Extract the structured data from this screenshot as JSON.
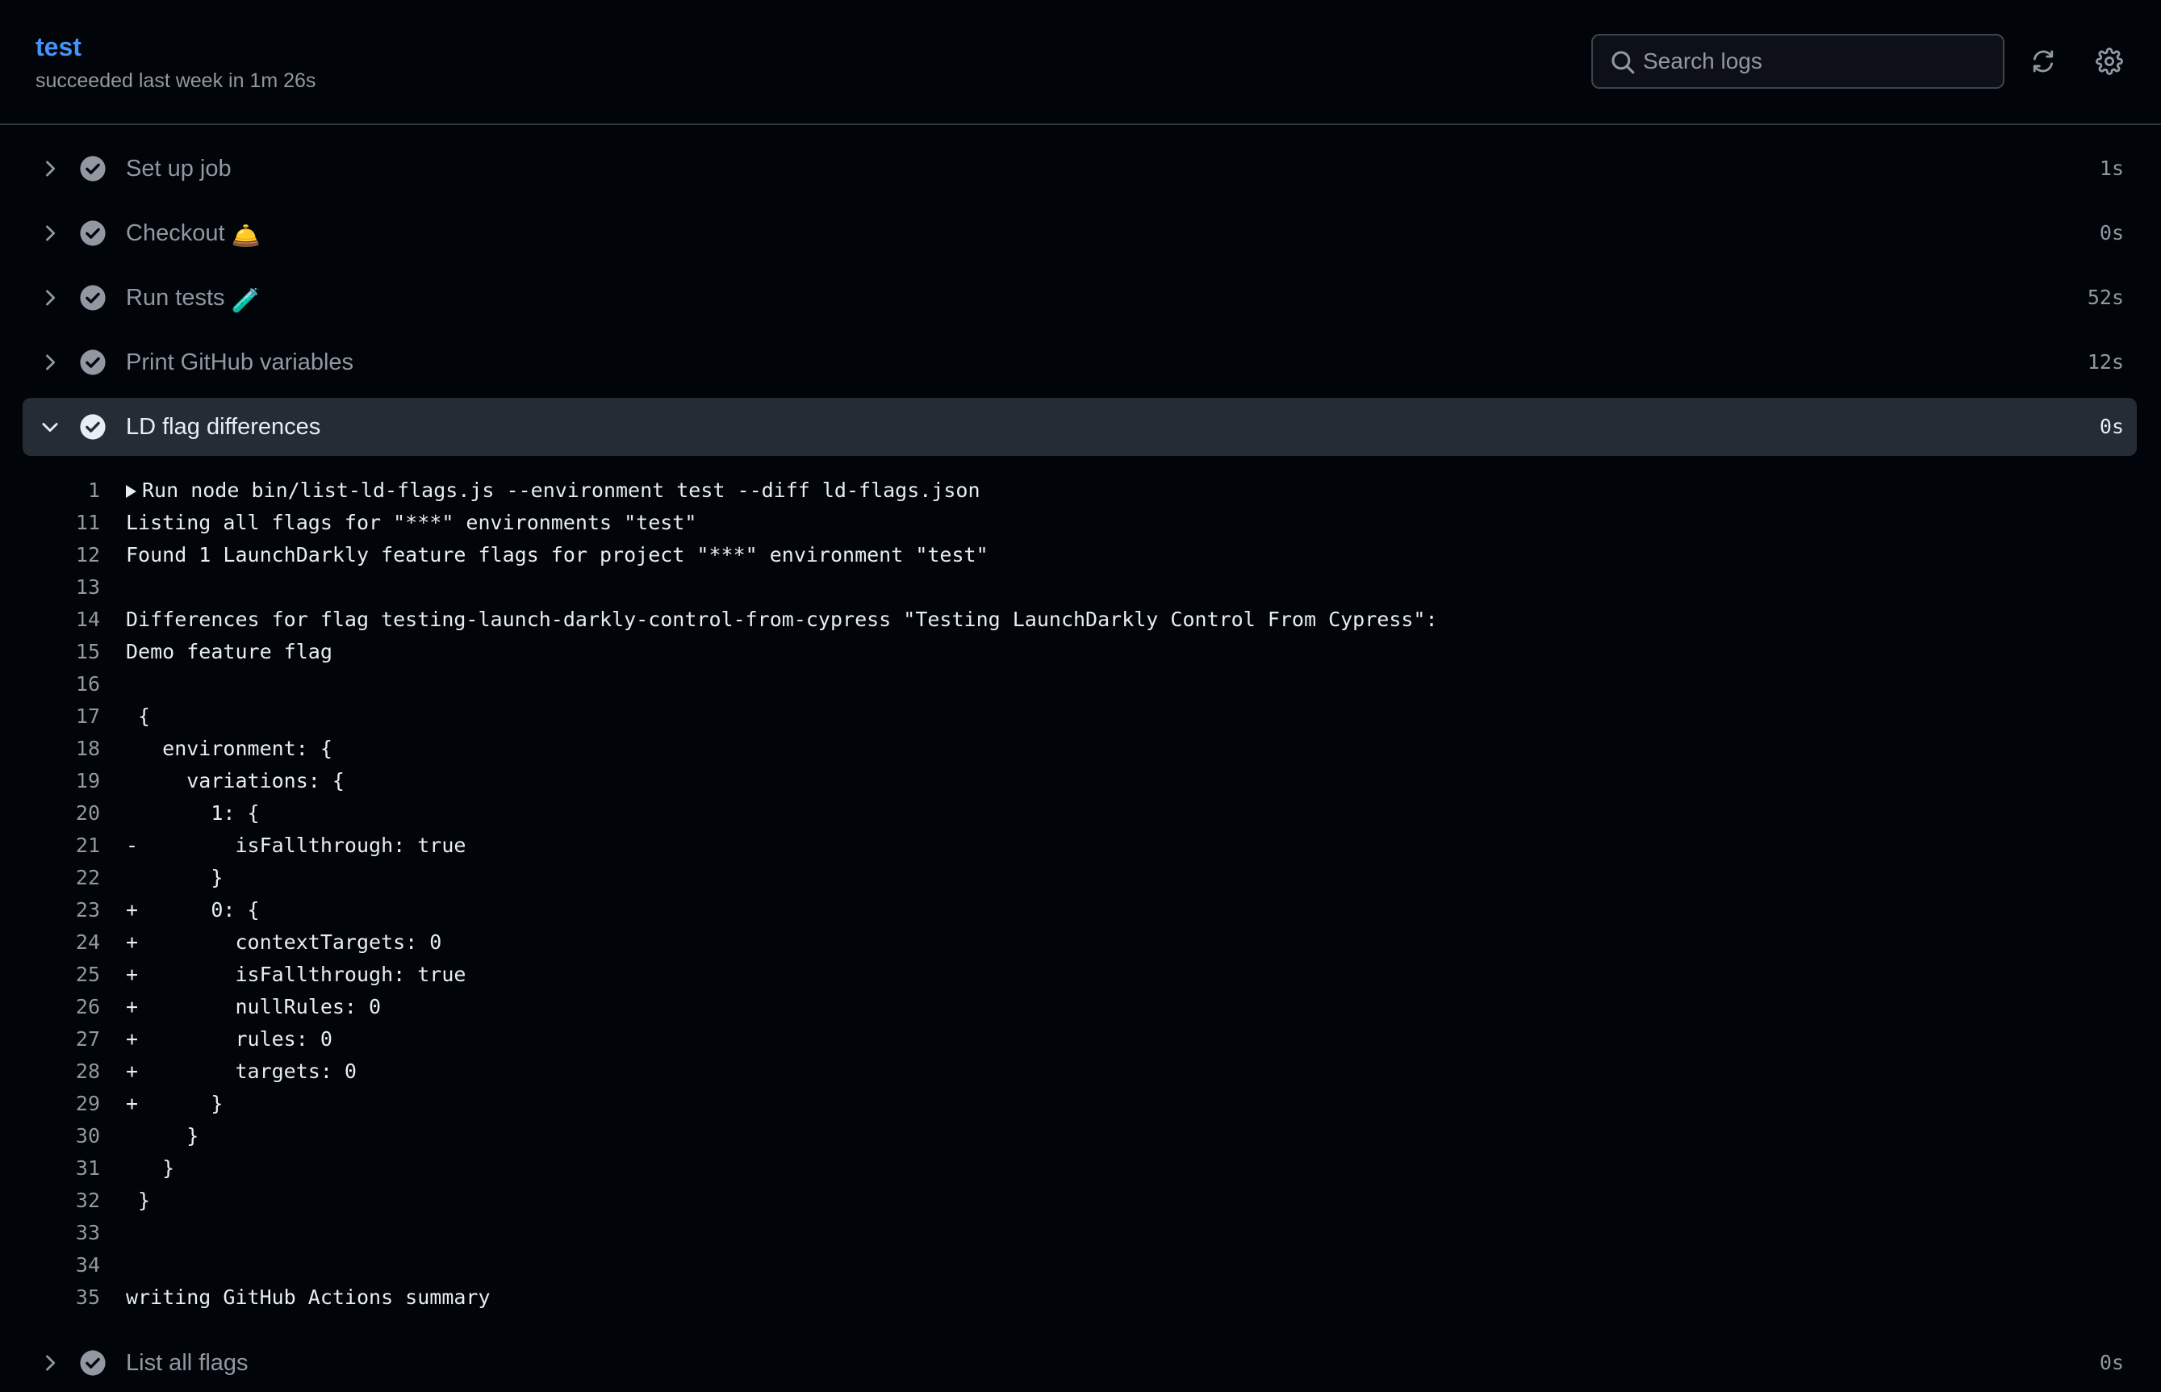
{
  "header": {
    "job_title": "test",
    "job_status": "succeeded last week in 1m 26s",
    "search_placeholder": "Search logs"
  },
  "steps_before": [
    {
      "label": "Set up job",
      "emoji": "",
      "duration": "1s"
    },
    {
      "label": "Checkout",
      "emoji": "🛎️",
      "duration": "0s"
    },
    {
      "label": "Run tests",
      "emoji": "🧪",
      "duration": "52s"
    },
    {
      "label": "Print GitHub variables",
      "emoji": "",
      "duration": "12s"
    }
  ],
  "expanded_step": {
    "label": "LD flag differences",
    "duration": "0s"
  },
  "log_lines": [
    {
      "num": "1",
      "text": "Run node bin/list-ld-flags.js --environment test --diff ld-flags.json",
      "collapsible": true
    },
    {
      "num": "11",
      "text": "Listing all flags for \"***\" environments \"test\""
    },
    {
      "num": "12",
      "text": "Found 1 LaunchDarkly feature flags for project \"***\" environment \"test\""
    },
    {
      "num": "13",
      "text": ""
    },
    {
      "num": "14",
      "text": "Differences for flag testing-launch-darkly-control-from-cypress \"Testing LaunchDarkly Control From Cypress\":"
    },
    {
      "num": "15",
      "text": "Demo feature flag"
    },
    {
      "num": "16",
      "text": ""
    },
    {
      "num": "17",
      "text": " {"
    },
    {
      "num": "18",
      "text": "   environment: {"
    },
    {
      "num": "19",
      "text": "     variations: {"
    },
    {
      "num": "20",
      "text": "       1: {"
    },
    {
      "num": "21",
      "text": "-        isFallthrough: true"
    },
    {
      "num": "22",
      "text": "       }"
    },
    {
      "num": "23",
      "text": "+      0: {"
    },
    {
      "num": "24",
      "text": "+        contextTargets: 0"
    },
    {
      "num": "25",
      "text": "+        isFallthrough: true"
    },
    {
      "num": "26",
      "text": "+        nullRules: 0"
    },
    {
      "num": "27",
      "text": "+        rules: 0"
    },
    {
      "num": "28",
      "text": "+        targets: 0"
    },
    {
      "num": "29",
      "text": "+      }"
    },
    {
      "num": "30",
      "text": "     }"
    },
    {
      "num": "31",
      "text": "   }"
    },
    {
      "num": "32",
      "text": " }"
    },
    {
      "num": "33",
      "text": ""
    },
    {
      "num": "34",
      "text": ""
    },
    {
      "num": "35",
      "text": "writing GitHub Actions summary"
    }
  ],
  "steps_after": [
    {
      "label": "List all flags",
      "duration": "0s"
    }
  ],
  "colors": {
    "background": "#010409",
    "accent": "#4493f8",
    "muted": "#9198a1",
    "expanded_bg": "#262c36"
  }
}
